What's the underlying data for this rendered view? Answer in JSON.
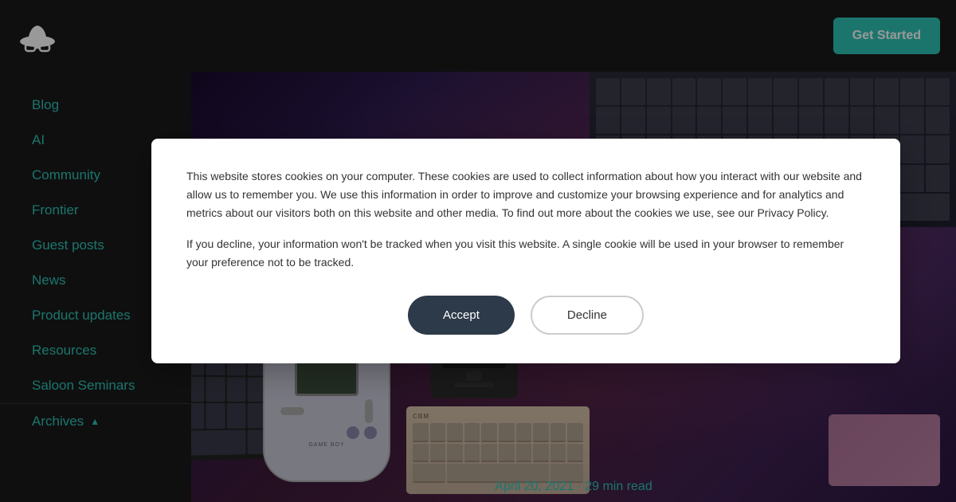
{
  "header": {
    "get_started_label": "Get Started"
  },
  "sidebar": {
    "items": [
      {
        "id": "blog",
        "label": "Blog"
      },
      {
        "id": "ai",
        "label": "AI"
      },
      {
        "id": "community",
        "label": "Community"
      },
      {
        "id": "frontier",
        "label": "Frontier"
      },
      {
        "id": "guest-posts",
        "label": "Guest posts"
      },
      {
        "id": "news",
        "label": "News"
      },
      {
        "id": "product-updates",
        "label": "Product updates"
      },
      {
        "id": "resources",
        "label": "Resources"
      },
      {
        "id": "saloon-seminars",
        "label": "Saloon Seminars"
      }
    ],
    "archives_label": "Archives",
    "archives_icon": "▲"
  },
  "hero": {
    "date": "April 20, 2021 · 29 min read"
  },
  "cookie_modal": {
    "paragraph1": "This website stores cookies on your computer. These cookies are used to collect information about how you interact with our website and allow us to remember you. We use this information in order to improve and customize your browsing experience and for analytics and metrics about our visitors both on this website and other media. To find out more about the cookies we use, see our Privacy Policy.",
    "paragraph2": "If you decline, your information won't be tracked when you visit this website. A single cookie will be used in your browser to remember your preference not to be tracked.",
    "accept_label": "Accept",
    "decline_label": "Decline"
  }
}
